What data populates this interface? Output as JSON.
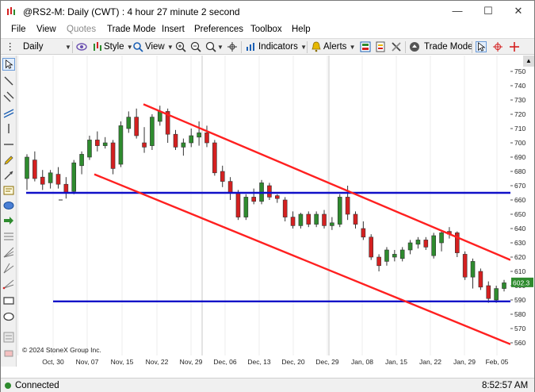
{
  "window": {
    "title": "@RS2-M: Daily (CWT) : 4 hour 27 minute 2 second",
    "controls": [
      "—",
      "☐",
      "✕"
    ]
  },
  "menu": {
    "items": [
      "File",
      "View",
      "Quotes",
      "Trade Mode",
      "Insert",
      "Preferences",
      "Toolbox",
      "Help"
    ],
    "disabled": [
      "Quotes"
    ]
  },
  "toolbar": {
    "interval": "Daily",
    "style_label": "Style",
    "view_label": "View",
    "indicators_label": "Indicators",
    "alerts_label": "Alerts",
    "trade_mode_label": "Trade Mode"
  },
  "status": {
    "connection": "Connected",
    "time": "8:52:57 AM"
  },
  "chart_data": {
    "type": "candlestick",
    "copyright": "© 2024 StoneX Group Inc.",
    "y_ticks": [
      750,
      740,
      730,
      720,
      710,
      700,
      690,
      680,
      670,
      660,
      650,
      640,
      630,
      620,
      610,
      600,
      590,
      580,
      570,
      560
    ],
    "ylim": [
      553,
      756
    ],
    "x_labels": [
      "Oct, 30",
      "Nov, 07",
      "Nov, 15",
      "Nov, 22",
      "Nov, 29",
      "Dec, 06",
      "Dec, 13",
      "Dec, 20",
      "Dec, 29",
      "Jan, 08",
      "Jan, 15",
      "Jan, 22",
      "Jan, 29",
      "Feb, 05"
    ],
    "last_price": "602.3",
    "last_price_color": "#000000",
    "up_color": "#2e8b2e",
    "down_color": "#d42020",
    "horizontal_lines": [
      {
        "price": 665,
        "color": "#1010c8"
      },
      {
        "price": 589,
        "color": "#1010c8"
      }
    ],
    "trend_lines": [
      {
        "from": [
          "Nov, 18",
          727
        ],
        "to": [
          "Feb, 09",
          620
        ],
        "color": "#ff2020"
      },
      {
        "from": [
          "Nov, 06",
          678
        ],
        "to": [
          "Feb, 09",
          558
        ],
        "color": "#ff2020"
      }
    ],
    "candles": [
      {
        "o": 675,
        "h": 692,
        "l": 667,
        "c": 690
      },
      {
        "o": 688,
        "h": 694,
        "l": 673,
        "c": 675
      },
      {
        "o": 676,
        "h": 681,
        "l": 667,
        "c": 671
      },
      {
        "o": 672,
        "h": 681,
        "l": 668,
        "c": 679
      },
      {
        "o": 678,
        "h": 683,
        "l": 668,
        "c": 671
      },
      {
        "o": 671,
        "h": 676,
        "l": 661,
        "c": 665
      },
      {
        "o": 666,
        "h": 688,
        "l": 664,
        "c": 686
      },
      {
        "o": 684,
        "h": 694,
        "l": 678,
        "c": 692
      },
      {
        "o": 690,
        "h": 705,
        "l": 688,
        "c": 702
      },
      {
        "o": 702,
        "h": 708,
        "l": 694,
        "c": 698
      },
      {
        "o": 698,
        "h": 704,
        "l": 696,
        "c": 700
      },
      {
        "o": 700,
        "h": 702,
        "l": 678,
        "c": 682
      },
      {
        "o": 685,
        "h": 715,
        "l": 683,
        "c": 712
      },
      {
        "o": 710,
        "h": 722,
        "l": 707,
        "c": 718
      },
      {
        "o": 718,
        "h": 724,
        "l": 703,
        "c": 705
      },
      {
        "o": 700,
        "h": 711,
        "l": 693,
        "c": 697
      },
      {
        "o": 698,
        "h": 720,
        "l": 695,
        "c": 718
      },
      {
        "o": 715,
        "h": 726,
        "l": 712,
        "c": 722
      },
      {
        "o": 722,
        "h": 724,
        "l": 700,
        "c": 706
      },
      {
        "o": 706,
        "h": 709,
        "l": 695,
        "c": 697
      },
      {
        "o": 697,
        "h": 703,
        "l": 691,
        "c": 700
      },
      {
        "o": 700,
        "h": 710,
        "l": 697,
        "c": 705
      },
      {
        "o": 704,
        "h": 715,
        "l": 698,
        "c": 707
      },
      {
        "o": 707,
        "h": 712,
        "l": 697,
        "c": 700
      },
      {
        "o": 700,
        "h": 702,
        "l": 677,
        "c": 679
      },
      {
        "o": 680,
        "h": 684,
        "l": 669,
        "c": 673
      },
      {
        "o": 673,
        "h": 676,
        "l": 660,
        "c": 665
      },
      {
        "o": 665,
        "h": 667,
        "l": 646,
        "c": 648
      },
      {
        "o": 648,
        "h": 664,
        "l": 646,
        "c": 662
      },
      {
        "o": 662,
        "h": 668,
        "l": 657,
        "c": 659
      },
      {
        "o": 659,
        "h": 674,
        "l": 657,
        "c": 672
      },
      {
        "o": 670,
        "h": 672,
        "l": 660,
        "c": 662
      },
      {
        "o": 663,
        "h": 664,
        "l": 658,
        "c": 661
      },
      {
        "o": 660,
        "h": 662,
        "l": 645,
        "c": 648
      },
      {
        "o": 648,
        "h": 652,
        "l": 640,
        "c": 642
      },
      {
        "o": 642,
        "h": 651,
        "l": 640,
        "c": 650
      },
      {
        "o": 650,
        "h": 652,
        "l": 641,
        "c": 643
      },
      {
        "o": 643,
        "h": 652,
        "l": 641,
        "c": 650
      },
      {
        "o": 650,
        "h": 653,
        "l": 640,
        "c": 642
      },
      {
        "o": 642,
        "h": 648,
        "l": 639,
        "c": 644
      },
      {
        "o": 643,
        "h": 664,
        "l": 641,
        "c": 662
      },
      {
        "o": 662,
        "h": 670,
        "l": 646,
        "c": 650
      },
      {
        "o": 650,
        "h": 652,
        "l": 640,
        "c": 643
      },
      {
        "o": 640,
        "h": 645,
        "l": 632,
        "c": 634
      },
      {
        "o": 634,
        "h": 636,
        "l": 618,
        "c": 620
      },
      {
        "o": 620,
        "h": 622,
        "l": 610,
        "c": 614
      },
      {
        "o": 617,
        "h": 627,
        "l": 614,
        "c": 625
      },
      {
        "o": 620,
        "h": 625,
        "l": 617,
        "c": 622
      },
      {
        "o": 619,
        "h": 627,
        "l": 617,
        "c": 625
      },
      {
        "o": 625,
        "h": 632,
        "l": 622,
        "c": 630
      },
      {
        "o": 629,
        "h": 634,
        "l": 626,
        "c": 632
      },
      {
        "o": 632,
        "h": 634,
        "l": 625,
        "c": 627
      },
      {
        "o": 621,
        "h": 637,
        "l": 619,
        "c": 635
      },
      {
        "o": 630,
        "h": 639,
        "l": 624,
        "c": 637
      },
      {
        "o": 638,
        "h": 641,
        "l": 633,
        "c": 636
      },
      {
        "o": 637,
        "h": 638,
        "l": 620,
        "c": 623
      },
      {
        "o": 622,
        "h": 624,
        "l": 604,
        "c": 606
      },
      {
        "o": 606,
        "h": 619,
        "l": 598,
        "c": 617
      },
      {
        "o": 610,
        "h": 612,
        "l": 597,
        "c": 599
      },
      {
        "o": 600,
        "h": 603,
        "l": 588,
        "c": 591
      },
      {
        "o": 590,
        "h": 600,
        "l": 588,
        "c": 598
      },
      {
        "o": 598,
        "h": 604,
        "l": 596,
        "c": 602
      }
    ]
  }
}
